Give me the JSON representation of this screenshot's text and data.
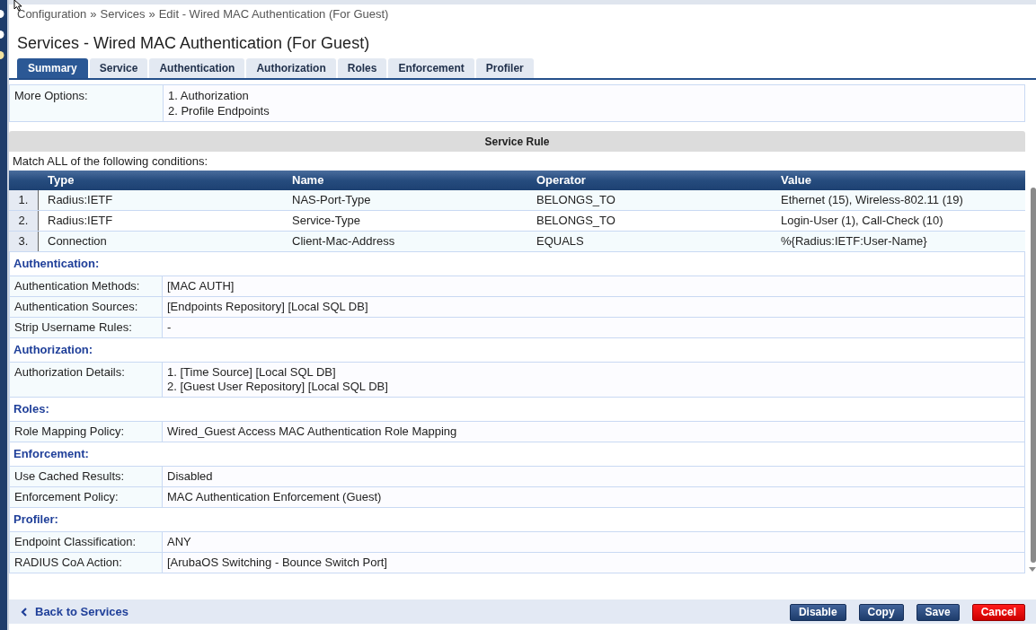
{
  "breadcrumb": {
    "separator": "»",
    "items": [
      "Configuration",
      "Services",
      "Edit - Wired MAC Authentication (For Guest)"
    ]
  },
  "title": "Services - Wired MAC Authentication (For Guest)",
  "tabs": [
    {
      "label": "Summary",
      "selected": true
    },
    {
      "label": "Service",
      "selected": false
    },
    {
      "label": "Authentication",
      "selected": false
    },
    {
      "label": "Authorization",
      "selected": false
    },
    {
      "label": "Roles",
      "selected": false
    },
    {
      "label": "Enforcement",
      "selected": false
    },
    {
      "label": "Profiler",
      "selected": false
    }
  ],
  "more_options": {
    "label": "More Options:",
    "values": [
      "1. Authorization",
      "2. Profile Endpoints"
    ]
  },
  "service_rule": {
    "title": "Service Rule",
    "match_text": "Match ALL of the following conditions:",
    "columns": [
      "Type",
      "Name",
      "Operator",
      "Value"
    ],
    "rows": [
      {
        "index": "1.",
        "cells": [
          "Radius:IETF",
          "NAS-Port-Type",
          "BELONGS_TO",
          "Ethernet (15), Wireless-802.11 (19)"
        ]
      },
      {
        "index": "2.",
        "cells": [
          "Radius:IETF",
          "Service-Type",
          "BELONGS_TO",
          "Login-User (1), Call-Check (10)"
        ]
      },
      {
        "index": "3.",
        "cells": [
          "Connection",
          "Client-Mac-Address",
          "EQUALS",
          "%{Radius:IETF:User-Name}"
        ]
      }
    ]
  },
  "sections": [
    {
      "title": "Authentication:",
      "rows": [
        {
          "label": "Authentication Methods:",
          "values": [
            "[MAC AUTH]"
          ]
        },
        {
          "label": "Authentication Sources:",
          "values": [
            "[Endpoints Repository] [Local SQL DB]"
          ]
        },
        {
          "label": "Strip Username Rules:",
          "values": [
            "-"
          ]
        }
      ]
    },
    {
      "title": "Authorization:",
      "rows": [
        {
          "label": "Authorization Details:",
          "values": [
            "1. [Time Source] [Local SQL DB]",
            "2. [Guest User Repository] [Local SQL DB]"
          ]
        }
      ]
    },
    {
      "title": "Roles:",
      "rows": [
        {
          "label": "Role Mapping Policy:",
          "values": [
            "Wired_Guest Access MAC Authentication Role Mapping"
          ]
        }
      ]
    },
    {
      "title": "Enforcement:",
      "rows": [
        {
          "label": "Use Cached Results:",
          "values": [
            "Disabled"
          ]
        },
        {
          "label": "Enforcement Policy:",
          "values": [
            "MAC Authentication Enforcement (Guest)"
          ]
        }
      ]
    },
    {
      "title": "Profiler:",
      "rows": [
        {
          "label": "Endpoint Classification:",
          "values": [
            "ANY"
          ]
        },
        {
          "label": "RADIUS CoA Action:",
          "values": [
            "[ArubaOS Switching - Bounce Switch Port]"
          ]
        }
      ]
    }
  ],
  "footer": {
    "back_link": "Back to Services",
    "buttons": [
      {
        "label": "Disable",
        "kind": "primary"
      },
      {
        "label": "Copy",
        "kind": "primary"
      },
      {
        "label": "Save",
        "kind": "primary"
      },
      {
        "label": "Cancel",
        "kind": "danger"
      }
    ]
  }
}
